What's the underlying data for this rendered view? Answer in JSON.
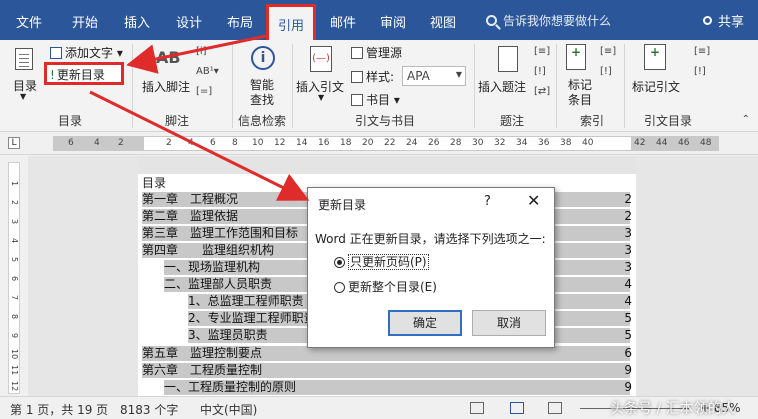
{
  "tabs": [
    "文件",
    "开始",
    "插入",
    "设计",
    "布局",
    "引用",
    "邮件",
    "审阅",
    "视图"
  ],
  "active_tab": "引用",
  "tell_me": "告诉我你想要做什么",
  "share": "共享",
  "ribbon": {
    "toc_button": "目录",
    "add_text": "添加文字",
    "update_toc": "更新目录",
    "toc_group": "目录",
    "ab_label": "AB",
    "insert_footnote": "插入脚注",
    "footnote_group": "脚注",
    "smart_lookup": "智能\n查找",
    "info_group": "信息检索",
    "insert_citation": "插入引文",
    "manage_sources": "管理源",
    "style_label": "样式:",
    "style_value": "APA",
    "bibliography": "书目",
    "citations_group": "引文与书目",
    "insert_caption": "插入题注",
    "captions_group": "题注",
    "mark_entry": "标记\n条目",
    "index_group": "索引",
    "mark_citation": "标记引文",
    "toa_group": "引文目录"
  },
  "ruler_numbers": [
    "6",
    "4",
    "2",
    "2",
    "4",
    "6",
    "8",
    "10",
    "12",
    "14",
    "16",
    "18",
    "20",
    "22",
    "24",
    "26",
    "28",
    "30",
    "32",
    "34",
    "36",
    "38",
    "40",
    "42",
    "44",
    "46",
    "48"
  ],
  "vruler_numbers": [
    "1",
    "2",
    "3",
    "4",
    "5",
    "6",
    "7",
    "8",
    "9",
    "10",
    "11",
    "12"
  ],
  "document": {
    "title": "目录",
    "lines": [
      {
        "text": "第一章　工程概况",
        "page": "2"
      },
      {
        "text": "第二章　监理依据",
        "page": "2"
      },
      {
        "text": "第三章　监理工作范围和目标",
        "page": "3"
      },
      {
        "text": "第四章　　监理组织机构",
        "page": "3"
      },
      {
        "text": "一、现场监理机构",
        "page": "3"
      },
      {
        "text": "二、监理部人员职责",
        "page": "4"
      },
      {
        "text": "1、总监理工程师职责",
        "page": "4"
      },
      {
        "text": "2、专业监理工程师职责",
        "page": "5"
      },
      {
        "text": "3、监理员职责",
        "page": "5"
      },
      {
        "text": "第五章　监理控制要点",
        "page": "6"
      },
      {
        "text": "第六章　工程质量控制",
        "page": "9"
      },
      {
        "text": "一、工程质量控制的原则",
        "page": "9"
      }
    ]
  },
  "dialog": {
    "title": "更新目录",
    "help": "?",
    "prompt": "Word 正在更新目录，请选择下列选项之一:",
    "option1": "只更新页码(P)",
    "option2": "更新整个目录(E)",
    "selected": "option1",
    "ok": "确定",
    "cancel": "取消"
  },
  "status": {
    "page": "第 1 页，共 19 页",
    "words": "8183 个字",
    "language": "中文(中国)",
    "zoom": "+ 85%"
  },
  "watermark": "头条号 / 汇本领的人",
  "colors": {
    "ribbon_blue": "#2b579a",
    "highlight_red": "#e02b2b",
    "toc_field_gray": "#c8c8c8"
  }
}
